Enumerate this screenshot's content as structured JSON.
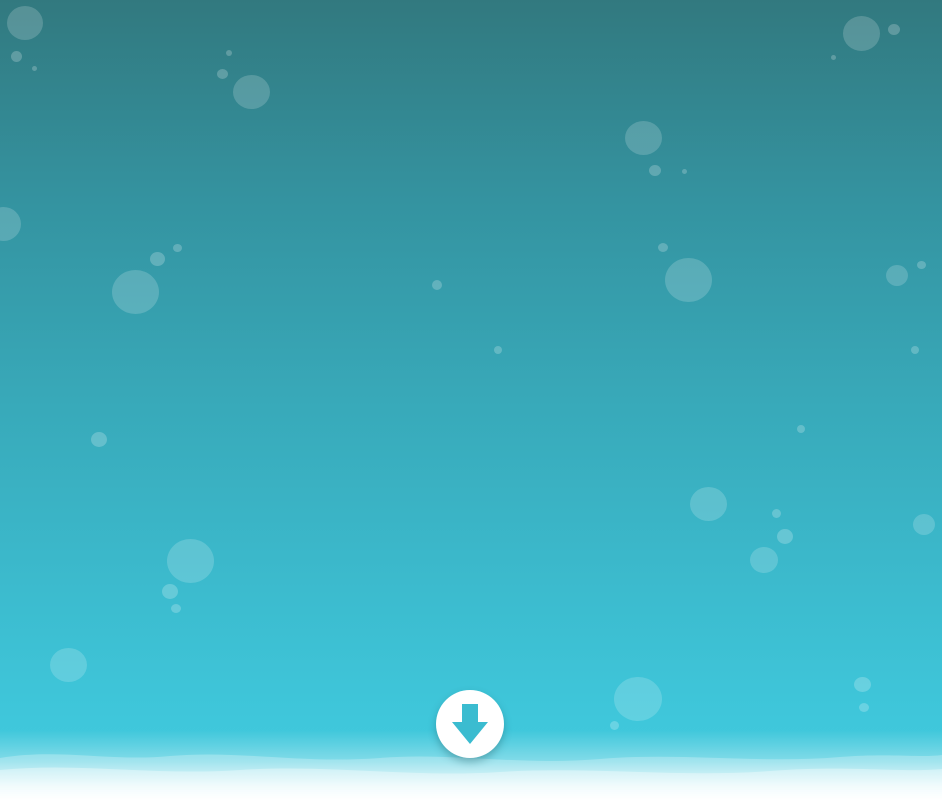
{
  "scene": {
    "description_colors": {
      "top": "#32797f",
      "bottom": "#42cade",
      "accent": "#3bbcd0"
    }
  },
  "scroll_button": {
    "icon": "arrow-down-icon",
    "color": "#3bbcd0"
  }
}
